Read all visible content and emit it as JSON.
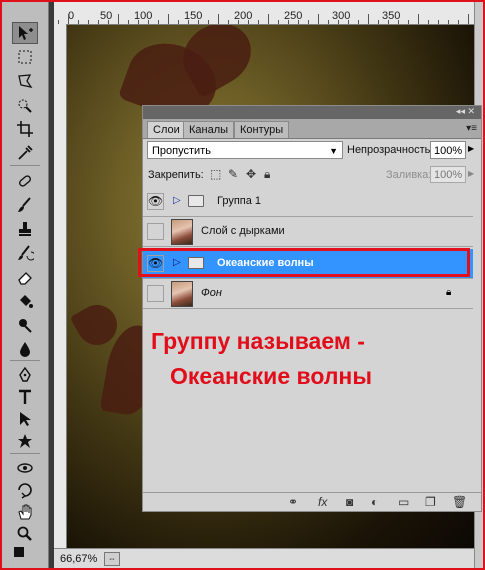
{
  "rulers": {
    "top_labels": [
      "0",
      "50",
      "100",
      "150",
      "200",
      "250",
      "300",
      "350"
    ]
  },
  "status": {
    "zoom": "66,67%"
  },
  "layers_panel": {
    "tabs": [
      "Слои",
      "Каналы",
      "Контуры"
    ],
    "blend_mode": "Пропустить",
    "opacity_label": "Непрозрачность:",
    "opacity_value": "100%",
    "lock_label": "Закрепить:",
    "fill_label": "Заливка:",
    "fill_value": "100%",
    "layers": [
      {
        "name": "Группа 1",
        "type": "group",
        "visible": true,
        "selected": false
      },
      {
        "name": "Слой с дырками",
        "type": "layer",
        "visible": false,
        "selected": false
      },
      {
        "name": "Океанские волны",
        "type": "group",
        "visible": true,
        "selected": true
      },
      {
        "name": "Фон",
        "type": "layer",
        "visible": false,
        "selected": false,
        "locked": true
      }
    ]
  },
  "annotation": {
    "line1": "Группу называем -",
    "line2": "Океанские волны"
  },
  "colors": {
    "accent": "#e20f1c",
    "selection": "#3393ff"
  }
}
